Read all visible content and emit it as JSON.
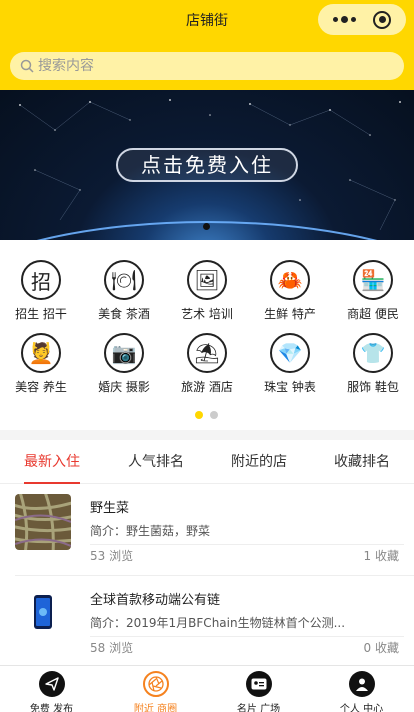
{
  "header": {
    "title": "店铺街",
    "capsule_more_icon": "more-dots-icon",
    "capsule_close_icon": "target-circle-icon"
  },
  "search": {
    "placeholder": "搜索内容",
    "icon": "search-icon"
  },
  "banner": {
    "button_label": "点击免费入住"
  },
  "categories": [
    {
      "label": "招生 招干",
      "icon": "招"
    },
    {
      "label": "美食 茶酒",
      "icon": "🍽"
    },
    {
      "label": "艺术 培训",
      "icon": "🖼"
    },
    {
      "label": "生鲜 特产",
      "icon": "🦀"
    },
    {
      "label": "商超 便民",
      "icon": "🏪"
    },
    {
      "label": "美容 养生",
      "icon": "💆"
    },
    {
      "label": "婚庆 摄影",
      "icon": "📷"
    },
    {
      "label": "旅游 酒店",
      "icon": "⛱"
    },
    {
      "label": "珠宝 钟表",
      "icon": "💎"
    },
    {
      "label": "服饰 鞋包",
      "icon": "👕"
    }
  ],
  "tabs": [
    {
      "label": "最新入住"
    },
    {
      "label": "人气排名"
    },
    {
      "label": "附近的店"
    },
    {
      "label": "收藏排名"
    }
  ],
  "stores": [
    {
      "name": "野生菜",
      "desc": "简介：野生菌菇，野菜",
      "views": "53 浏览",
      "favorites": "1 收藏"
    },
    {
      "name": "全球首款移动端公有链",
      "desc": "简介：2019年1月BFChain生物链林首个公测...",
      "views": "58 浏览",
      "favorites": "0 收藏"
    }
  ],
  "nav": [
    {
      "label": "免费 发布",
      "icon": "paper-plane-icon"
    },
    {
      "label": "附近 商圈",
      "icon": "aperture-icon"
    },
    {
      "label": "名片 广场",
      "icon": "id-card-icon"
    },
    {
      "label": "个人 中心",
      "icon": "user-icon"
    }
  ],
  "colors": {
    "brand_yellow": "#ffd700",
    "active_tab": "#e8392f",
    "active_nav": "#f5821f"
  }
}
